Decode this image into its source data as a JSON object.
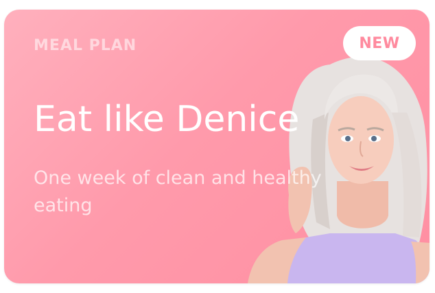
{
  "card": {
    "eyebrow": "MEAL PLAN",
    "title": "Eat like Denice",
    "subtitle": "One week of clean and healthy eating",
    "badge": "NEW",
    "photo_icon": "person-photo"
  },
  "colors": {
    "card_gradient_start": "#ffb0bd",
    "card_gradient_end": "#ff8fa2",
    "badge_bg": "#ffffff",
    "badge_text": "#ff8a9e",
    "top_color": "#c9b6ef"
  }
}
